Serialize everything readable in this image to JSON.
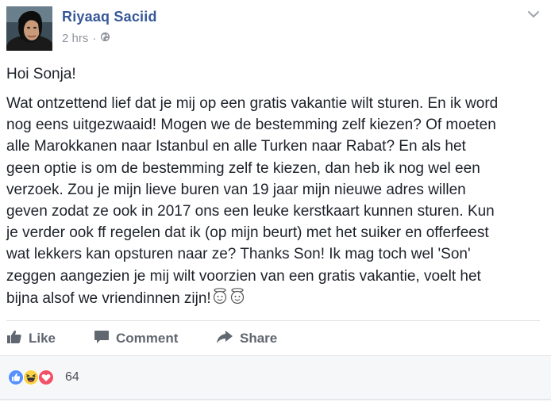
{
  "post": {
    "author": "Riyaaq Saciid",
    "time": "2 hrs",
    "privacy_icon": "globe-icon",
    "greeting": "Hoi Sonja!",
    "lines": [
      "Wat ontzettend lief dat je mij op een gratis vakantie wilt sturen. En ik word",
      "nog eens uitgezwaaid! Mogen we de bestemming zelf kiezen? Of moeten",
      "alle Marokkanen naar Istanbul en alle Turken naar Rabat? En als het",
      "geen optie is om de bestemming zelf te kiezen, dan heb ik nog wel een",
      "verzoek. Zou je mijn lieve buren van 19 jaar mijn nieuwe adres willen",
      "geven zodat ze ook in 2017 ons een leuke kerstkaart kunnen sturen. Kun",
      "je verder ook ff regelen dat ik (op mijn beurt) met het suiker en offerfeest",
      "wat lekkers kan opsturen naar ze? Thanks Son! Ik mag toch wel 'Son'",
      "zeggen aangezien je mij wilt voorzien van een gratis vakantie, voelt het",
      "bijna alsof we vriendinnen zijn!"
    ]
  },
  "actions": {
    "like": "Like",
    "comment": "Comment",
    "share": "Share"
  },
  "reactions": {
    "icons": [
      "like-reaction-icon",
      "haha-reaction-icon",
      "love-reaction-icon"
    ],
    "count": "64"
  },
  "colors": {
    "link": "#365899",
    "like_blue": "#5890ff",
    "love_red": "#f25268",
    "haha_yellow": "#fcd344"
  }
}
